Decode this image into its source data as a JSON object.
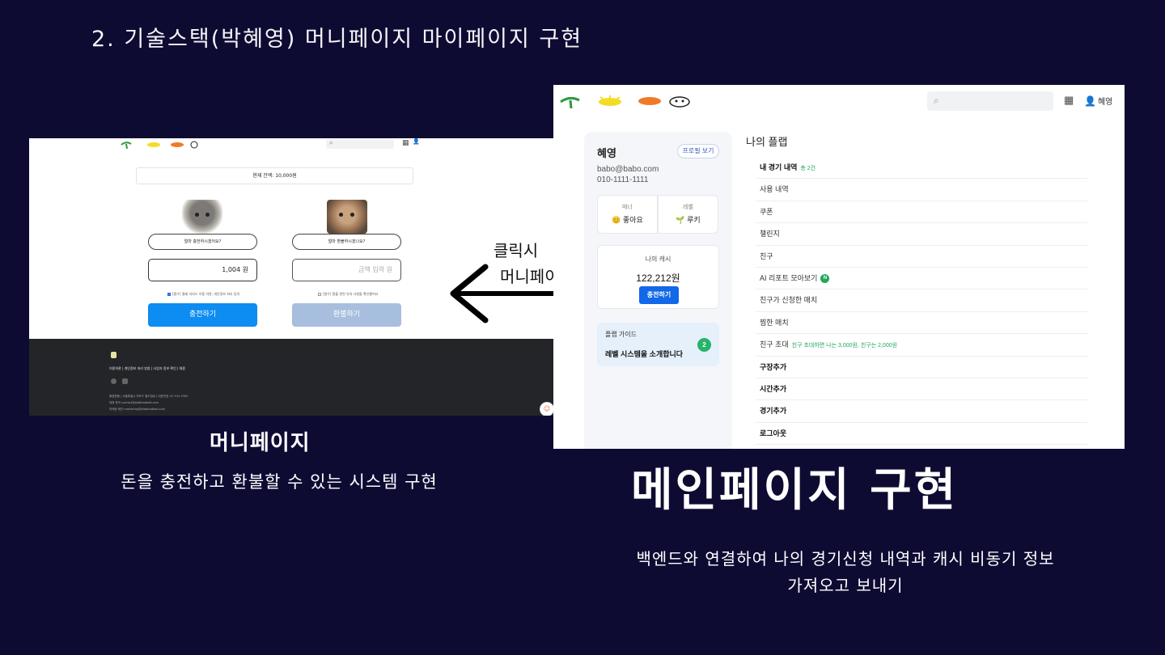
{
  "slide": {
    "title": "2. 기술스택(박혜영) 머니페이지 마이페이지 구현"
  },
  "money_page": {
    "balance_text": "현재 잔액: 10,000원",
    "charge_question": "얼마 충전하시겠어요?",
    "refund_question": "얼마 환불하시겠나요?",
    "charge_amount": "1,004 원",
    "refund_placeholder": "금액 입력 원",
    "charge_agree": "[필수] 결제 서비스 이용 약관, 개인정보 처리 동의",
    "refund_agree": "[필수] 환불 관련 유의 사항을 확인했어요",
    "charge_button": "충전하기",
    "refund_button": "환불하기",
    "footer_links": "이용약관 | 개인정보 처리 방침 | 사업자 정보 확인 | 채용",
    "footer_info": [
      "플랩풋볼 | 서울특별시 마포구 월드컵로 | 대표번호 02-704-7963",
      "제휴 문의 contact@plabfootball.com",
      "마케팅 제안 marketing@plabfootball.com"
    ],
    "caption_title": "머니페이지",
    "caption_desc": "돈을 충전하고 환불할 수 있는 시스템 구현"
  },
  "annotation": {
    "line1": "클릭시",
    "line2": "머니페이지 이동"
  },
  "main_page": {
    "user_name": "혜영",
    "header_user": "혜영",
    "profile_button": "프로필 보기",
    "email": "babo@babo.com",
    "phone": "010-1111-1111",
    "manner_label": "매너",
    "manner_value": "😊 좋아요",
    "level_label": "레벨",
    "level_value": "루키",
    "cash_label": "나의 캐시",
    "cash_value": "122,212원",
    "cash_button": "충전하기",
    "guide_label": "플랩 가이드",
    "guide_text": "레벨 시스템을 소개합니다",
    "guide_badge": "2",
    "section_title": "나의 플랩",
    "menu": [
      {
        "label": "내 경기 내역",
        "note": "총 2건"
      },
      {
        "label": "사용 내역"
      },
      {
        "label": "쿠폰"
      },
      {
        "label": "챌린지"
      },
      {
        "label": "친구"
      },
      {
        "label": "AI 리포트 모아보기",
        "badge": "N"
      },
      {
        "label": "친구가 신청한 매치"
      },
      {
        "label": "찜한 매치"
      },
      {
        "label": "친구 초대",
        "note": "친구 초대하면 나는 3,000원, 친구는 2,000원"
      },
      {
        "label": "구장추가"
      },
      {
        "label": "시간추가"
      },
      {
        "label": "경기추가"
      },
      {
        "label": "로그아웃"
      }
    ],
    "caption_title": "메인페이지 구현",
    "caption_desc": "백엔드와 연결하여 나의 경기신청 내역과 캐시 비동기 정보 가져오고 보내기"
  }
}
